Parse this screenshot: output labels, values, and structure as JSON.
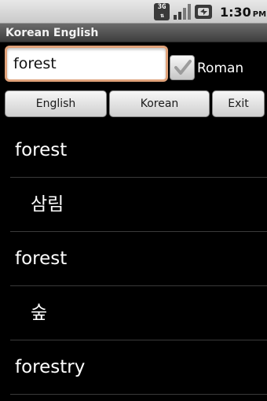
{
  "status_bar": {
    "network": "3G",
    "time": "1:30",
    "ampm": "PM",
    "icons": [
      "3g-icon",
      "signal-icon",
      "battery-icon"
    ]
  },
  "app": {
    "title": "Korean English"
  },
  "search": {
    "value": "forest",
    "roman_checked": true,
    "roman_label": "Roman"
  },
  "buttons": {
    "english": "English",
    "korean": "Korean",
    "exit": "Exit"
  },
  "results": [
    {
      "type": "term",
      "text": "forest"
    },
    {
      "type": "translation",
      "text": "삼림"
    },
    {
      "type": "term",
      "text": "forest"
    },
    {
      "type": "translation",
      "text": "숲"
    },
    {
      "type": "term",
      "text": "forestry"
    }
  ],
  "colors": {
    "background": "#000000",
    "input_focus_border": "#e0a27a",
    "divider": "#3a3a3a"
  }
}
